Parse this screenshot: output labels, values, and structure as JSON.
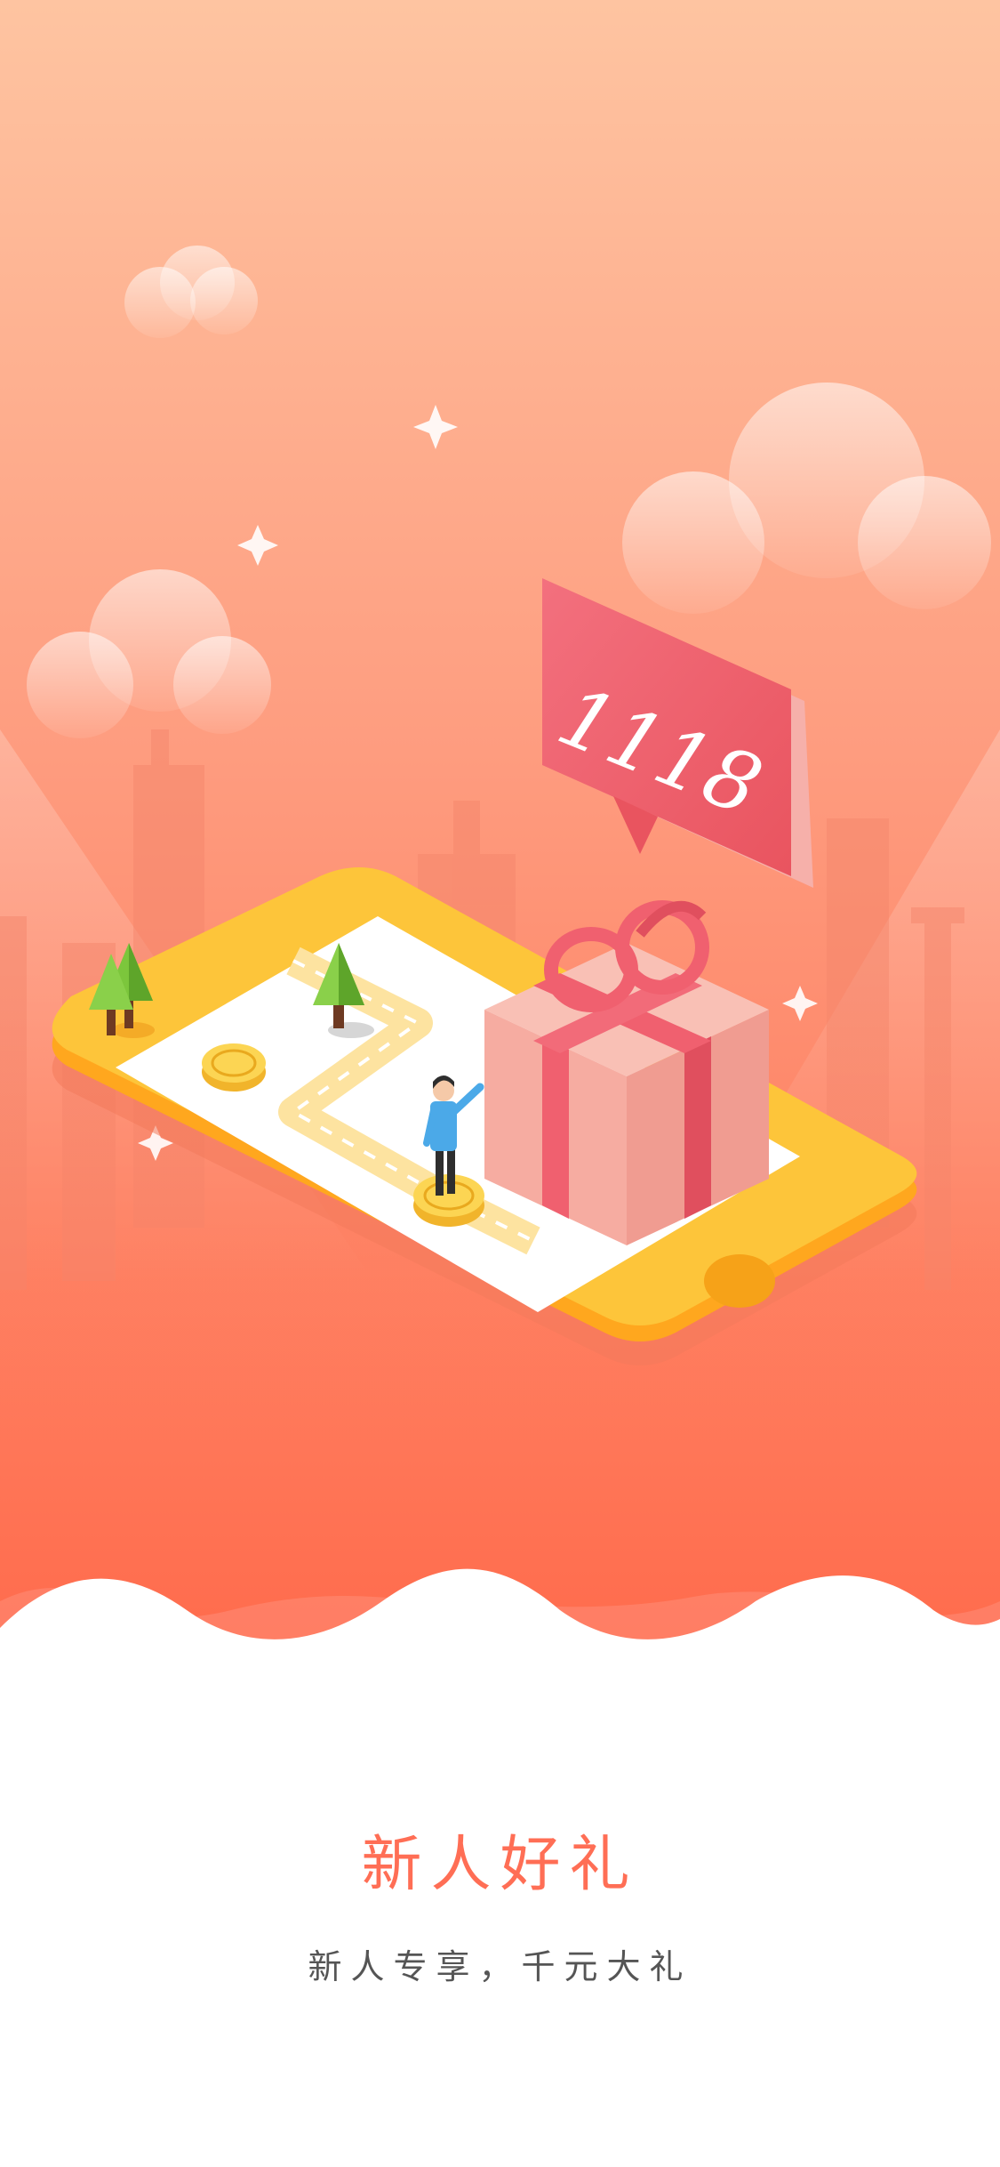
{
  "onboarding": {
    "badge_number": "1118",
    "title": "新人好礼",
    "subtitle": "新人专享，千元大礼"
  },
  "colors": {
    "sky_top": "#FEC4A1",
    "sky_bottom": "#FF6A4B",
    "phone_body": "#FDC53A",
    "gift": "#F8B1A7",
    "ribbon": "#F0606F",
    "title": "#FF6E55",
    "subtitle": "#555555"
  },
  "icons": [
    "cloud-icon",
    "sparkle-icon",
    "tree-icon",
    "coin-icon",
    "person-icon",
    "gift-box-icon",
    "speech-bubble-icon"
  ]
}
